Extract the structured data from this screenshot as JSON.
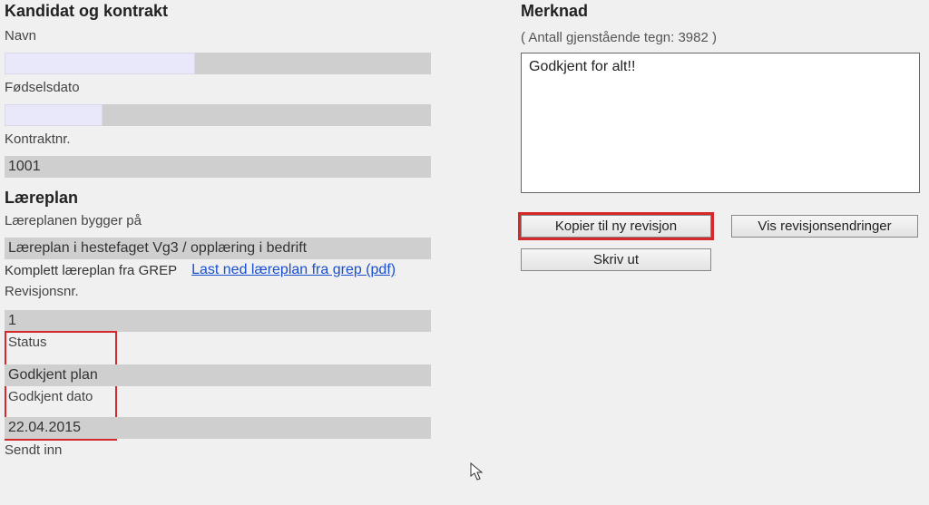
{
  "left": {
    "section1_header": "Kandidat og kontrakt",
    "navn_label": "Navn",
    "navn_value": "",
    "fdato_label": "Fødselsdato",
    "fdato_value": "",
    "kontraktnr_label": "Kontraktnr.",
    "kontraktnr_value": "1001",
    "section2_header": "Læreplan",
    "lareplan_label": "Læreplanen bygger på",
    "lareplan_value": "Læreplan i hestefaget Vg3 / opplæring i bedrift",
    "grep_text": "Komplett læreplan fra GREP",
    "grep_link": "Last ned læreplan fra grep (pdf)",
    "revnr_label": "Revisjonsnr.",
    "revnr_value": "1",
    "status_label": "Status",
    "status_value": " Godkjent plan",
    "godkjent_dato_label": "Godkjent dato",
    "godkjent_dato_value": "22.04.2015",
    "sendt_inn_label": "Sendt inn"
  },
  "right": {
    "section_header": "Merknad",
    "char_count_text": "( Antall gjenstående tegn: 3982 )",
    "merknad_value": "Godkjent for alt!!",
    "btn_kopier": "Kopier til ny revisjon",
    "btn_vis": "Vis revisjonsendringer",
    "btn_skriv": "Skriv ut"
  }
}
